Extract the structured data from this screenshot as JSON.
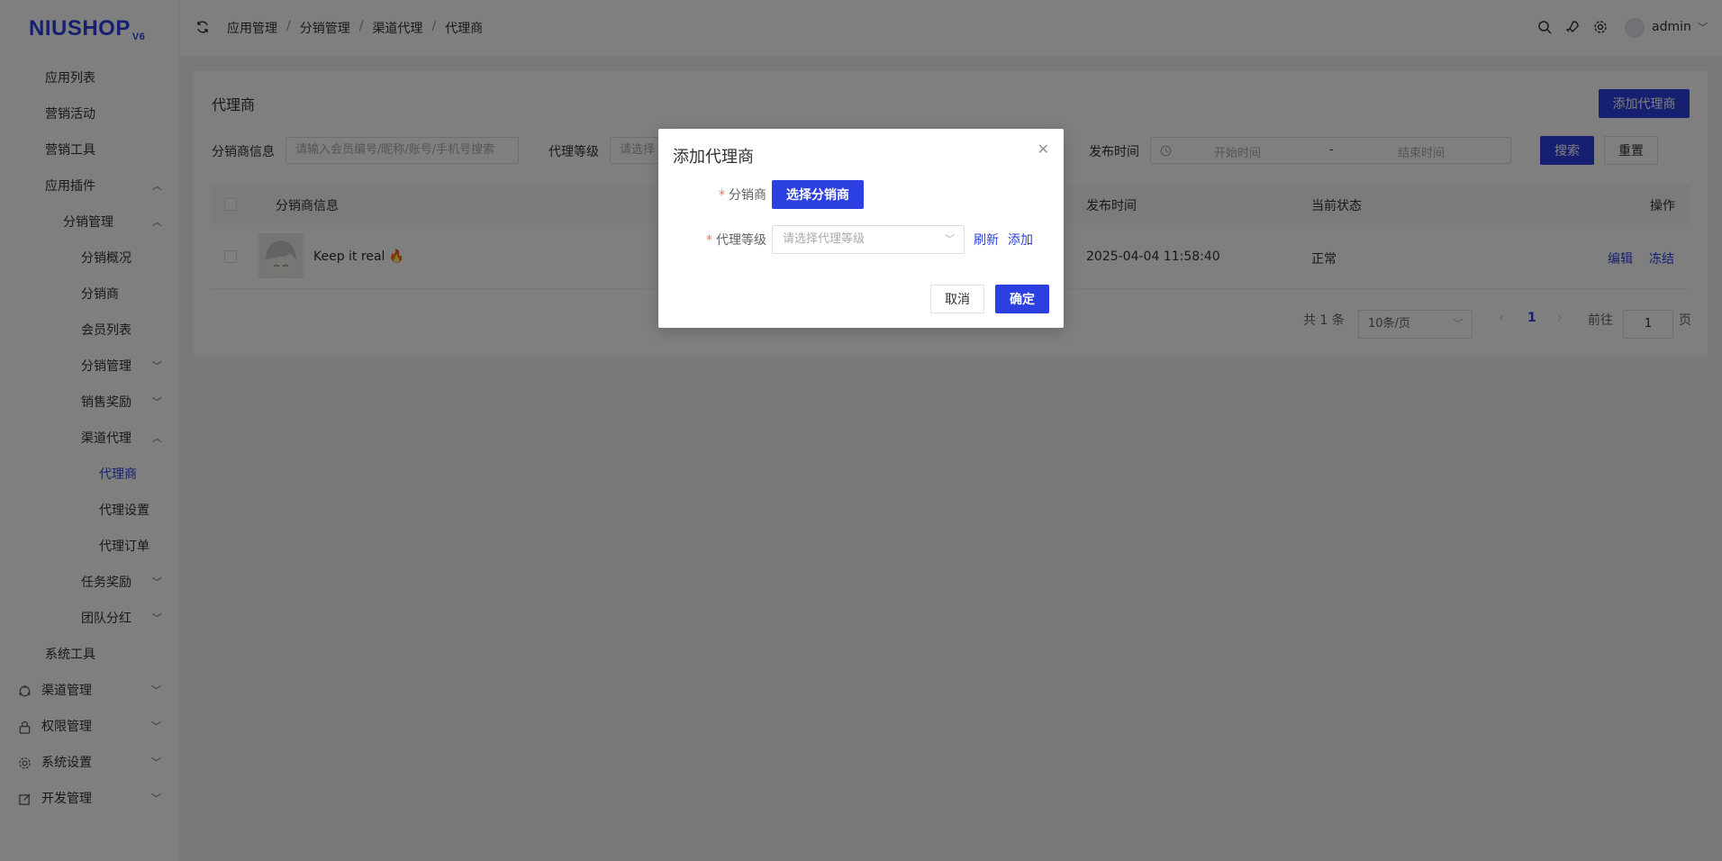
{
  "logo": {
    "text": "NIUSHOP",
    "version": "V6"
  },
  "sidebar": {
    "items": [
      {
        "label": "应用列表"
      },
      {
        "label": "营销活动"
      },
      {
        "label": "营销工具"
      },
      {
        "label": "应用插件"
      },
      {
        "label": "分销管理"
      },
      {
        "label": "分销概况"
      },
      {
        "label": "分销商"
      },
      {
        "label": "会员列表"
      },
      {
        "label": "分销管理"
      },
      {
        "label": "销售奖励"
      },
      {
        "label": "渠道代理"
      },
      {
        "label": "代理商"
      },
      {
        "label": "代理设置"
      },
      {
        "label": "代理订单"
      },
      {
        "label": "任务奖励"
      },
      {
        "label": "团队分红"
      },
      {
        "label": "系统工具"
      },
      {
        "label": "渠道管理"
      },
      {
        "label": "权限管理"
      },
      {
        "label": "系统设置"
      },
      {
        "label": "开发管理"
      }
    ]
  },
  "header": {
    "breadcrumbs": [
      "应用管理",
      "分销管理",
      "渠道代理",
      "代理商"
    ],
    "separator": "/",
    "username": "admin"
  },
  "main": {
    "title": "代理商",
    "add_button": "添加代理商",
    "filters": {
      "distributor_label": "分销商信息",
      "distributor_placeholder": "请输入会员编号/昵称/账号/手机号搜索",
      "level_label": "代理等级",
      "level_placeholder": "请选择",
      "time_label": "发布时间",
      "start_placeholder": "开始时间",
      "end_placeholder": "结束时间",
      "range_sep": "-",
      "search_button": "搜索",
      "reset_button": "重置"
    },
    "table": {
      "headers": [
        "分销商信息",
        "发布时间",
        "当前状态",
        "操作"
      ],
      "rows": [
        {
          "name": "Keep it real 🔥",
          "time": "2025-04-04 11:58:40",
          "status": "正常",
          "edit": "编辑",
          "freeze": "冻结"
        }
      ]
    },
    "pagination": {
      "total": "共 1 条",
      "page_size": "10条/页",
      "current": "1",
      "goto_label": "前往",
      "goto_value": "1",
      "page_unit": "页"
    }
  },
  "dialog": {
    "title": "添加代理商",
    "distributor_label": "分销商",
    "select_button": "选择分销商",
    "level_label": "代理等级",
    "level_placeholder": "请选择代理等级",
    "refresh": "刷新",
    "add": "添加",
    "cancel": "取消",
    "confirm": "确定",
    "required_mark": "*"
  },
  "colors": {
    "primary": "#2c3fe0",
    "danger": "#f56c6c"
  }
}
